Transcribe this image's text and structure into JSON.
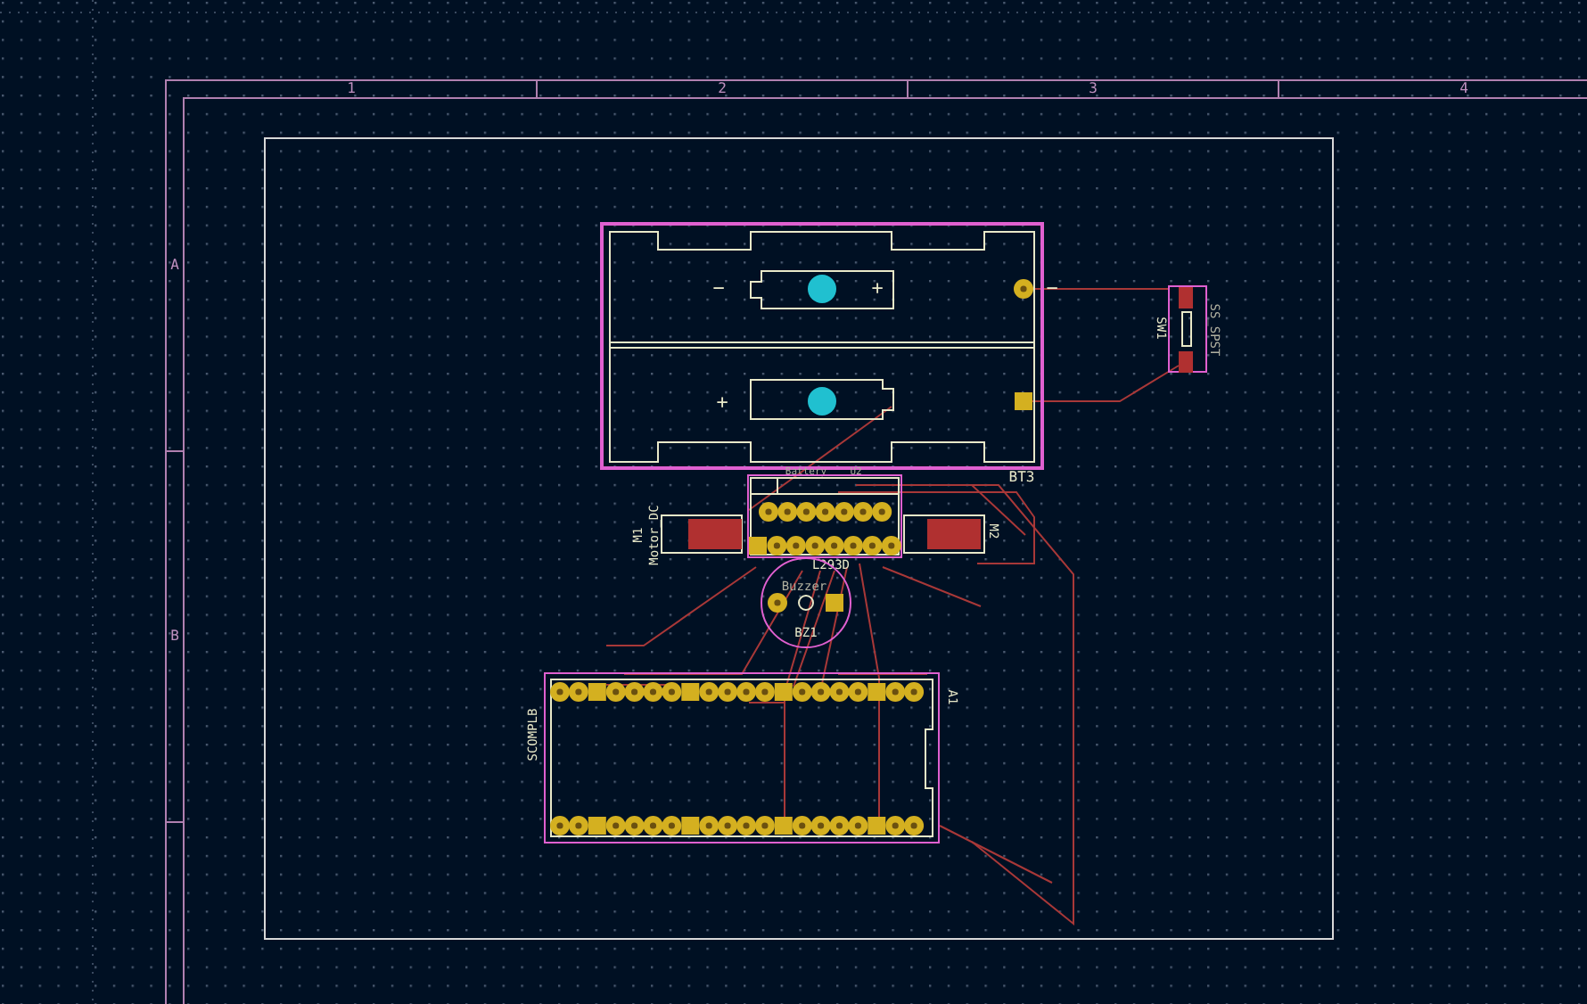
{
  "frame": {
    "columns": [
      "1",
      "2",
      "3",
      "4"
    ],
    "rows": [
      "A",
      "B"
    ]
  },
  "components": [
    {
      "kind": "battery",
      "reference": "BT3",
      "value": "Battery",
      "polarity": [
        "−",
        "+",
        "−",
        "+"
      ]
    },
    {
      "kind": "switch",
      "reference": "SW1",
      "value": "SS_SPST"
    },
    {
      "kind": "driver",
      "reference": "U2",
      "value": "L293D"
    },
    {
      "kind": "motor",
      "reference": "M1",
      "value": "Motor_DC"
    },
    {
      "kind": "motor",
      "reference": "M2"
    },
    {
      "kind": "buzzer",
      "reference": "BZ1",
      "value": "Buzzer"
    },
    {
      "kind": "arduino",
      "reference": "A1",
      "value": "SCOMPLB"
    }
  ]
}
